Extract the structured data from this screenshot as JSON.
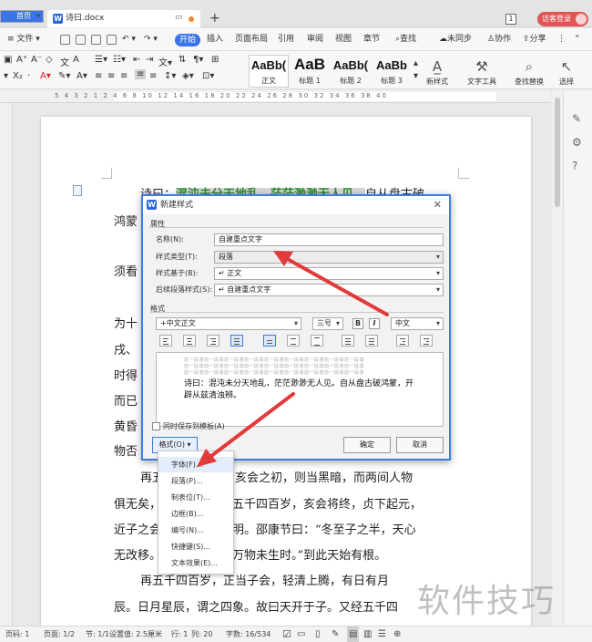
{
  "tabs": {
    "home": "首页",
    "doc_title": "诗曰.docx"
  },
  "window": {
    "badge": "1",
    "login": "访客登录"
  },
  "menubar": {
    "file": "≡ 文件 ▾",
    "start": "开始",
    "items": [
      "插入",
      "页面布局",
      "引用",
      "审阅",
      "视图",
      "章节"
    ],
    "search": "查找",
    "sync": "未同步",
    "collab": "协作",
    "share": "分享"
  },
  "ribbon": {
    "styles": [
      {
        "preview": "AaBb(",
        "caption": "正文"
      },
      {
        "preview": "AaB",
        "caption": "标题 1"
      },
      {
        "preview": "AaBb(",
        "caption": "标题 2"
      },
      {
        "preview": "AaBb",
        "caption": "标题 3"
      }
    ],
    "new_style": "新样式",
    "text_tools": "文字工具",
    "find_replace": "查找替换",
    "select": "选择"
  },
  "ruler": {
    "numbers": "5  4  3  2  1     2  4  6  8  10  12  14  16  18  20  22  24  26  28  30  32  34  36  38  40"
  },
  "document": {
    "line1_prefix": "诗曰：",
    "line1_highlight": "混沌未分天地乱，茫茫渺渺无人见。",
    "line1_suffix": "自从盘古破",
    "line2": "鸿蒙",
    "line3": "须看",
    "line4": "为十",
    "line5": "戌、",
    "line6": "时得",
    "line7": "而已",
    "line8": "黄昏",
    "line9": "物否",
    "line10": "再五千四百岁，交亥会之初，则当黑暗，而两间人物",
    "line11": "俱无矣，故曰混沌。又五千四百岁，亥会将终，贞下起元，",
    "line12": "近子之会，而复逐渐开明。邵康节曰：“冬至子之半，天心",
    "line13": "无改移。一阳初动处，万物未生时。”到此天始有根。",
    "line14": "再五千四百岁，正当子会，轻清上腾，有日有月",
    "line15": "辰。日月星辰，谓之四象。故曰天开于子。又经五千四"
  },
  "dialog": {
    "title": "新建样式",
    "section_props": "属性",
    "name_label": "名称(N):",
    "name_value": "自建重点文字",
    "type_label": "样式类型(T):",
    "type_value": "段落",
    "base_label": "样式基于(B):",
    "base_value": "↵ 正文",
    "next_label": "后续段落样式(S):",
    "next_value": "↵ 自建重点文字",
    "section_format": "格式",
    "font_value": "+中文正文",
    "size_value": "三号",
    "bold": "B",
    "italic": "I",
    "lang_value": "中文",
    "preview_grey": "前一段落前一段落前一段落前一段落前一段落前一段落前一段落前一段落前一段落",
    "preview_text": "诗曰：混沌未分天地乱，茫茫渺渺无人见。自从盘古破鸿蒙，开辟从兹清浊辨。",
    "save_template": "同时保存到模板(A)",
    "format_btn": "格式(O)",
    "ok": "确定",
    "cancel": "取消"
  },
  "format_menu": [
    "字体(F)...",
    "段落(P)...",
    "制表位(T)...",
    "边框(B)...",
    "编号(N)...",
    "快捷键(S)...",
    "文本效果(E)..."
  ],
  "statusbar": {
    "page": "页码: 1",
    "pages": "页面: 1/2",
    "section": "节: 1/1",
    "setting": "设置值: 2.5厘米",
    "row": "行: 1",
    "col": "列: 20",
    "words": "字数: 16/534"
  },
  "watermark": "软件技巧"
}
